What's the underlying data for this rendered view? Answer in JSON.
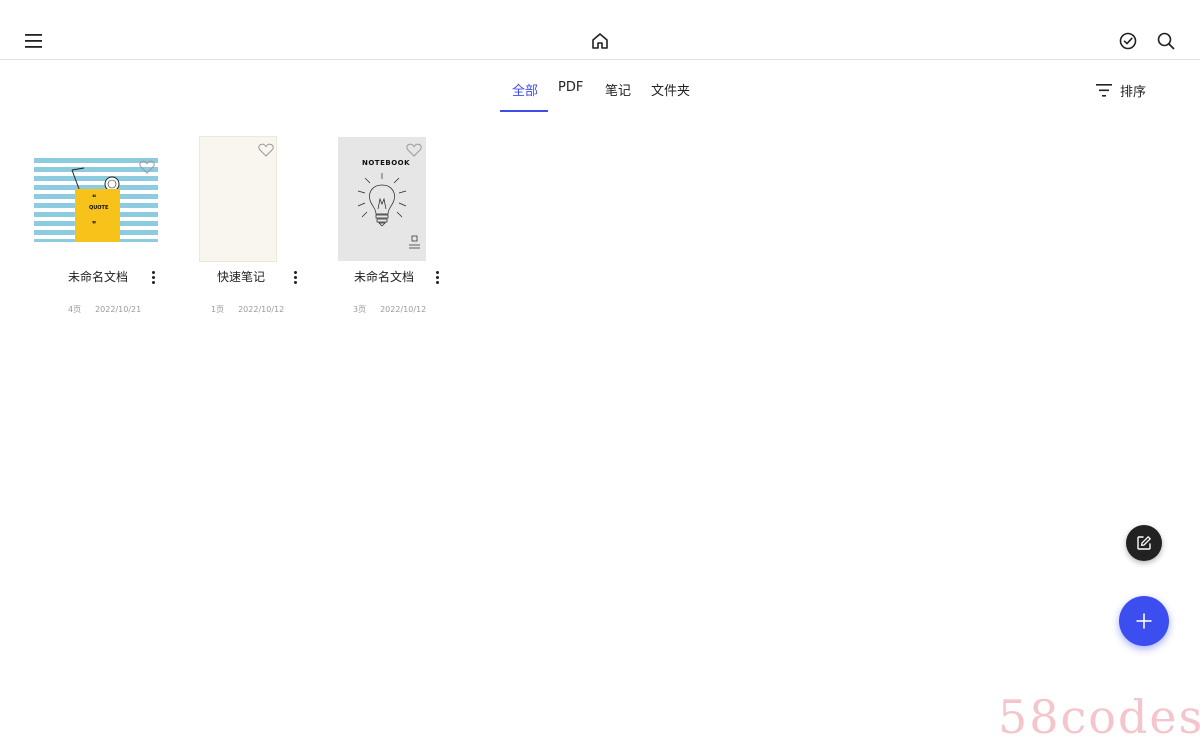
{
  "toolbar": {
    "menu_icon": "menu-icon",
    "home_icon": "home-icon",
    "select_icon": "check-circle-icon",
    "search_icon": "search-icon"
  },
  "tabs": [
    {
      "label": "全部",
      "active": true
    },
    {
      "label": "PDF",
      "active": false
    },
    {
      "label": "笔记",
      "active": false
    },
    {
      "label": "文件夹",
      "active": false
    }
  ],
  "sort": {
    "label": "排序",
    "icon": "sort-icon"
  },
  "documents": [
    {
      "title": "未命名文档",
      "pages": "4页",
      "date": "2022/10/21",
      "cover": "quote-cover",
      "cover_text": {
        "quote": "QUOTE",
        "open_mark": "❝",
        "close_mark": "❞"
      }
    },
    {
      "title": "快速笔记",
      "pages": "1页",
      "date": "2022/10/12",
      "cover": "blank-cover"
    },
    {
      "title": "未命名文档",
      "pages": "3页",
      "date": "2022/10/12",
      "cover": "notebook-cover",
      "cover_text": {
        "notebook": "NOTEBOOK"
      }
    }
  ],
  "fab": {
    "edit_icon": "edit-icon",
    "add_icon": "plus-icon"
  },
  "watermark": "58codes",
  "colors": {
    "accent": "#3d4de6",
    "fab": "#3d4ef0",
    "stripe": "#8ccbe0",
    "note_yellow": "#f7c21a"
  }
}
